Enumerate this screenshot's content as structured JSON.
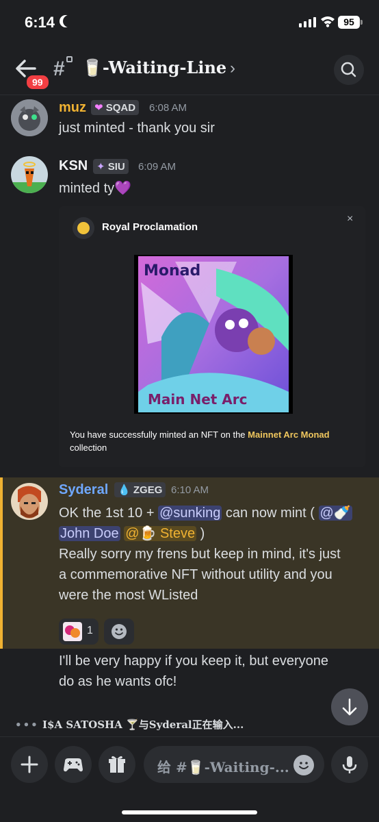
{
  "status_bar": {
    "time": "6:14",
    "battery": "95"
  },
  "header": {
    "unread_badge": "99",
    "channel_name": "🥛-Waiting-Line",
    "chevron": "›"
  },
  "messages": [
    {
      "author": "muz",
      "author_color": "#f0b232",
      "tag": "SQAD",
      "time": "6:08 AM",
      "text": "just minted - thank you sir"
    },
    {
      "author": "KSN",
      "author_color": "#f2f3f5",
      "tag": "SIU",
      "time": "6:09 AM",
      "text": "minted ty💜"
    }
  ],
  "embed": {
    "title": "Royal Proclamation",
    "close": "×",
    "text_prefix": "You have successfully minted an NFT on the ",
    "text_highlight": "Mainnet Arc Monad",
    "text_suffix": "collection",
    "nft_title_top": "Monad",
    "nft_title_bottom": "Main Net Arc"
  },
  "highlight_message": {
    "author": "Syderal",
    "author_color": "#6fa8ff",
    "tag": "ZGEG",
    "time": "6:10 AM",
    "line1_a": "OK the 1st 10 + ",
    "line1_mention": "@sunking",
    "line1_b": " can now mint ( ",
    "line1_mention2": "@🍼",
    "line2_a": "John Doe",
    "line2_mention": "@🍺 Steve",
    "line2_b": " )",
    "line3": "Really sorry my frens but keep in mind, it's just",
    "line4": "a commemorative NFT without utility and you",
    "line5": "were the most WListed",
    "reaction_count": "1"
  },
  "followup": {
    "line1": "I'll be very happy if you keep it, but everyone",
    "line2": "do as he wants ofc!"
  },
  "typing": {
    "dots": "•••",
    "text": "I$A SATOSHA 🍸与Syderal正在输入..."
  },
  "composer": {
    "placeholder": "给 #🥛-Waiting-..."
  }
}
